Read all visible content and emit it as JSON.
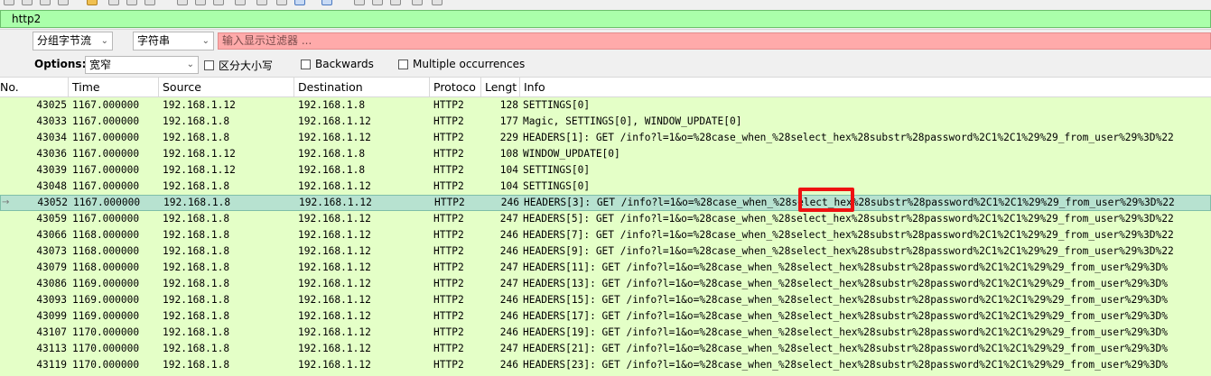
{
  "display_filter": {
    "value": "http2"
  },
  "find": {
    "search_in": "分组字节流",
    "search_type": "字符串",
    "placeholder": "输入显示过滤器 ..."
  },
  "options": {
    "label": "Options:",
    "charset": "宽窄",
    "case_sensitive": "区分大小写",
    "backwards": "Backwards",
    "multiple": "Multiple occurrences"
  },
  "columns": {
    "no": "No.",
    "time": "Time",
    "source": "Source",
    "destination": "Destination",
    "protocol": "Protoco",
    "length": "Lengt",
    "info": "Info"
  },
  "colors": {
    "row_bg": "#e4ffc7",
    "selected_bg": "#b7e2d0",
    "filter_ok": "#aaffaa",
    "search_bad": "#ffaaaa",
    "annotation": "#ee1111"
  },
  "rows": [
    {
      "no": "43025",
      "time": "1167.000000",
      "src": "192.168.1.12",
      "dst": "192.168.1.8",
      "proto": "HTTP2",
      "len": "128",
      "info": "SETTINGS[0]"
    },
    {
      "no": "43033",
      "time": "1167.000000",
      "src": "192.168.1.8",
      "dst": "192.168.1.12",
      "proto": "HTTP2",
      "len": "177",
      "info": "Magic, SETTINGS[0], WINDOW_UPDATE[0]"
    },
    {
      "no": "43034",
      "time": "1167.000000",
      "src": "192.168.1.8",
      "dst": "192.168.1.12",
      "proto": "HTTP2",
      "len": "229",
      "info": "HEADERS[1]: GET /info?l=1&o=%28case_when_%28select_hex%28substr%28password%2C1%2C1%29%29_from_user%29%3D%22"
    },
    {
      "no": "43036",
      "time": "1167.000000",
      "src": "192.168.1.12",
      "dst": "192.168.1.8",
      "proto": "HTTP2",
      "len": "108",
      "info": "WINDOW_UPDATE[0]"
    },
    {
      "no": "43039",
      "time": "1167.000000",
      "src": "192.168.1.12",
      "dst": "192.168.1.8",
      "proto": "HTTP2",
      "len": "104",
      "info": "SETTINGS[0]"
    },
    {
      "no": "43048",
      "time": "1167.000000",
      "src": "192.168.1.8",
      "dst": "192.168.1.12",
      "proto": "HTTP2",
      "len": "104",
      "info": "SETTINGS[0]"
    },
    {
      "no": "43052",
      "time": "1167.000000",
      "src": "192.168.1.8",
      "dst": "192.168.1.12",
      "proto": "HTTP2",
      "len": "246",
      "info": "HEADERS[3]: GET /info?l=1&o=%28case_when_%28select_hex%28substr%28password%2C1%2C1%29%29_from_user%29%3D%22",
      "selected": true
    },
    {
      "no": "43059",
      "time": "1167.000000",
      "src": "192.168.1.8",
      "dst": "192.168.1.12",
      "proto": "HTTP2",
      "len": "247",
      "info": "HEADERS[5]: GET /info?l=1&o=%28case_when_%28select_hex%28substr%28password%2C1%2C1%29%29_from_user%29%3D%22"
    },
    {
      "no": "43066",
      "time": "1168.000000",
      "src": "192.168.1.8",
      "dst": "192.168.1.12",
      "proto": "HTTP2",
      "len": "246",
      "info": "HEADERS[7]: GET /info?l=1&o=%28case_when_%28select_hex%28substr%28password%2C1%2C1%29%29_from_user%29%3D%22"
    },
    {
      "no": "43073",
      "time": "1168.000000",
      "src": "192.168.1.8",
      "dst": "192.168.1.12",
      "proto": "HTTP2",
      "len": "246",
      "info": "HEADERS[9]: GET /info?l=1&o=%28case_when_%28select_hex%28substr%28password%2C1%2C1%29%29_from_user%29%3D%22"
    },
    {
      "no": "43079",
      "time": "1168.000000",
      "src": "192.168.1.8",
      "dst": "192.168.1.12",
      "proto": "HTTP2",
      "len": "247",
      "info": "HEADERS[11]: GET /info?l=1&o=%28case_when_%28select_hex%28substr%28password%2C1%2C1%29%29_from_user%29%3D%"
    },
    {
      "no": "43086",
      "time": "1169.000000",
      "src": "192.168.1.8",
      "dst": "192.168.1.12",
      "proto": "HTTP2",
      "len": "247",
      "info": "HEADERS[13]: GET /info?l=1&o=%28case_when_%28select_hex%28substr%28password%2C1%2C1%29%29_from_user%29%3D%"
    },
    {
      "no": "43093",
      "time": "1169.000000",
      "src": "192.168.1.8",
      "dst": "192.168.1.12",
      "proto": "HTTP2",
      "len": "246",
      "info": "HEADERS[15]: GET /info?l=1&o=%28case_when_%28select_hex%28substr%28password%2C1%2C1%29%29_from_user%29%3D%"
    },
    {
      "no": "43099",
      "time": "1169.000000",
      "src": "192.168.1.8",
      "dst": "192.168.1.12",
      "proto": "HTTP2",
      "len": "246",
      "info": "HEADERS[17]: GET /info?l=1&o=%28case_when_%28select_hex%28substr%28password%2C1%2C1%29%29_from_user%29%3D%"
    },
    {
      "no": "43107",
      "time": "1170.000000",
      "src": "192.168.1.8",
      "dst": "192.168.1.12",
      "proto": "HTTP2",
      "len": "246",
      "info": "HEADERS[19]: GET /info?l=1&o=%28case_when_%28select_hex%28substr%28password%2C1%2C1%29%29_from_user%29%3D%"
    },
    {
      "no": "43113",
      "time": "1170.000000",
      "src": "192.168.1.8",
      "dst": "192.168.1.12",
      "proto": "HTTP2",
      "len": "247",
      "info": "HEADERS[21]: GET /info?l=1&o=%28case_when_%28select_hex%28substr%28password%2C1%2C1%29%29_from_user%29%3D%"
    },
    {
      "no": "43119",
      "time": "1170.000000",
      "src": "192.168.1.8",
      "dst": "192.168.1.12",
      "proto": "HTTP2",
      "len": "246",
      "info": "HEADERS[23]: GET /info?l=1&o=%28case_when_%28select_hex%28substr%28password%2C1%2C1%29%29_from_user%29%3D%"
    }
  ]
}
